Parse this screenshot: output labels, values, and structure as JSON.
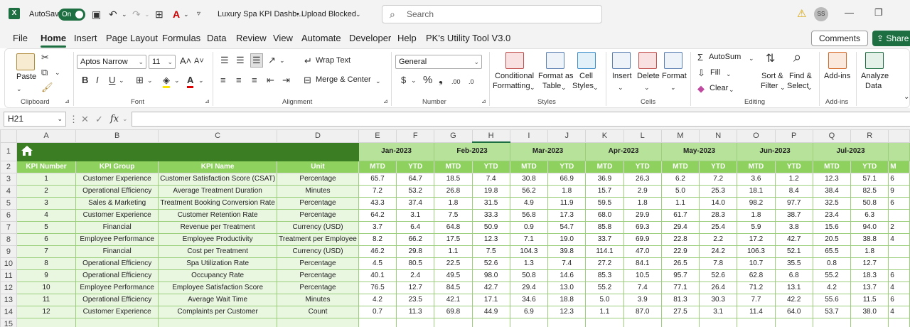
{
  "titlebar": {
    "autosave_label": "AutoSave",
    "autosave_state": "On",
    "file_title": "Luxury Spa KPI Dashb...",
    "status": "• Upload Blocked",
    "search_placeholder": "Search",
    "user_initials": "SS"
  },
  "menu": [
    "File",
    "Home",
    "Insert",
    "Page Layout",
    "Formulas",
    "Data",
    "Review",
    "View",
    "Automate",
    "Developer",
    "Help",
    "PK's Utility Tool V3.0"
  ],
  "menu_active": "Home",
  "buttons": {
    "comments": "Comments",
    "share": "Share"
  },
  "ribbon": {
    "clipboard": {
      "paste": "Paste",
      "label": "Clipboard"
    },
    "font": {
      "name": "Aptos Narrow",
      "size": "11",
      "label": "Font"
    },
    "alignment": {
      "wrap": "Wrap Text",
      "merge": "Merge & Center",
      "label": "Alignment"
    },
    "number": {
      "format": "General",
      "label": "Number"
    },
    "styles": {
      "cond_l1": "Conditional",
      "cond_l2": "Formatting",
      "fmt_l1": "Format as",
      "fmt_l2": "Table",
      "cell_l1": "Cell",
      "cell_l2": "Styles",
      "label": "Styles"
    },
    "cells": {
      "insert": "Insert",
      "delete": "Delete",
      "format": "Format",
      "label": "Cells"
    },
    "editing": {
      "autosum": "AutoSum",
      "fill": "Fill",
      "clear": "Clear",
      "sort_l1": "Sort &",
      "sort_l2": "Filter",
      "find_l1": "Find &",
      "find_l2": "Select",
      "label": "Editing"
    },
    "addins": {
      "btn": "Add-ins",
      "label": "Add-ins"
    },
    "analyze": {
      "l1": "Analyze",
      "l2": "Data"
    }
  },
  "formula_bar": {
    "name_box": "H21",
    "fx": "fx",
    "content": ""
  },
  "sheet": {
    "columns": [
      "A",
      "B",
      "C",
      "D",
      "E",
      "F",
      "G",
      "H",
      "I",
      "J",
      "K",
      "L",
      "M",
      "N",
      "O",
      "P",
      "Q",
      "R",
      ""
    ],
    "selected_column": "H",
    "row_numbers": [
      "1",
      "2",
      "3",
      "4",
      "5",
      "6",
      "7",
      "8",
      "9",
      "10",
      "11",
      "12",
      "13",
      "14",
      "15"
    ],
    "months": [
      "Jan-2023",
      "Feb-2023",
      "Mar-2023",
      "Apr-2023",
      "May-2023",
      "Jun-2023",
      "Jul-2023"
    ],
    "header": {
      "kpi_number": "KPI Number",
      "kpi_group": "KPI Group",
      "kpi_name": "KPI Name",
      "unit": "Unit",
      "mtd": "MTD",
      "ytd": "YTD",
      "partial": "M"
    },
    "rows": [
      {
        "n": "1",
        "group": "Customer Experience",
        "name": "Customer Satisfaction Score (CSAT)",
        "unit": "Percentage",
        "vals": [
          "65.7",
          "64.7",
          "18.5",
          "7.4",
          "30.8",
          "66.9",
          "36.9",
          "26.3",
          "6.2",
          "7.2",
          "3.6",
          "1.2",
          "12.3",
          "57.1"
        ],
        "edge": "6"
      },
      {
        "n": "2",
        "group": "Operational Efficiency",
        "name": "Average Treatment Duration",
        "unit": "Minutes",
        "vals": [
          "7.2",
          "53.2",
          "26.8",
          "19.8",
          "56.2",
          "1.8",
          "15.7",
          "2.9",
          "5.0",
          "25.3",
          "18.1",
          "8.4",
          "38.4",
          "82.5"
        ],
        "edge": "9"
      },
      {
        "n": "3",
        "group": "Sales & Marketing",
        "name": "Treatment Booking Conversion Rate",
        "unit": "Percentage",
        "vals": [
          "43.3",
          "37.4",
          "1.8",
          "31.5",
          "4.9",
          "11.9",
          "59.5",
          "1.8",
          "1.1",
          "14.0",
          "98.2",
          "97.7",
          "32.5",
          "50.8"
        ],
        "edge": "6"
      },
      {
        "n": "4",
        "group": "Customer Experience",
        "name": "Customer Retention Rate",
        "unit": "Percentage",
        "vals": [
          "64.2",
          "3.1",
          "7.5",
          "33.3",
          "56.8",
          "17.3",
          "68.0",
          "29.9",
          "61.7",
          "28.3",
          "1.8",
          "38.7",
          "23.4",
          "6.3"
        ],
        "edge": ""
      },
      {
        "n": "5",
        "group": "Financial",
        "name": "Revenue per Treatment",
        "unit": "Currency (USD)",
        "vals": [
          "3.7",
          "6.4",
          "64.8",
          "50.9",
          "0.9",
          "54.7",
          "85.8",
          "69.3",
          "29.4",
          "25.4",
          "5.9",
          "3.8",
          "15.6",
          "94.0"
        ],
        "edge": "2"
      },
      {
        "n": "6",
        "group": "Employee Performance",
        "name": "Employee Productivity",
        "unit": "Treatment per Employee",
        "vals": [
          "8.2",
          "66.2",
          "17.5",
          "12.3",
          "7.1",
          "19.0",
          "33.7",
          "69.9",
          "22.8",
          "2.2",
          "17.2",
          "42.7",
          "20.5",
          "38.8"
        ],
        "edge": "4"
      },
      {
        "n": "7",
        "group": "Financial",
        "name": "Cost per Treatment",
        "unit": "Currency (USD)",
        "vals": [
          "46.2",
          "29.8",
          "1.1",
          "7.5",
          "104.3",
          "39.8",
          "114.1",
          "47.0",
          "22.9",
          "24.2",
          "106.3",
          "52.1",
          "65.5",
          "1.8"
        ],
        "edge": ""
      },
      {
        "n": "8",
        "group": "Operational Efficiency",
        "name": "Spa Utilization Rate",
        "unit": "Percentage",
        "vals": [
          "4.5",
          "80.5",
          "22.5",
          "52.6",
          "1.3",
          "7.4",
          "27.2",
          "84.1",
          "26.5",
          "7.8",
          "10.7",
          "35.5",
          "0.8",
          "12.7"
        ],
        "edge": ""
      },
      {
        "n": "9",
        "group": "Operational Efficiency",
        "name": "Occupancy Rate",
        "unit": "Percentage",
        "vals": [
          "40.1",
          "2.4",
          "49.5",
          "98.0",
          "50.8",
          "14.6",
          "85.3",
          "10.5",
          "95.7",
          "52.6",
          "62.8",
          "6.8",
          "55.2",
          "18.3"
        ],
        "edge": "6"
      },
      {
        "n": "10",
        "group": "Employee Performance",
        "name": "Employee Satisfaction Score",
        "unit": "Percentage",
        "vals": [
          "76.5",
          "12.7",
          "84.5",
          "42.7",
          "29.4",
          "13.0",
          "55.2",
          "7.4",
          "77.1",
          "26.4",
          "71.2",
          "13.1",
          "4.2",
          "13.7"
        ],
        "edge": "4"
      },
      {
        "n": "11",
        "group": "Operational Efficiency",
        "name": "Average Wait Time",
        "unit": "Minutes",
        "vals": [
          "4.2",
          "23.5",
          "42.1",
          "17.1",
          "34.6",
          "18.8",
          "5.0",
          "3.9",
          "81.3",
          "30.3",
          "7.7",
          "42.2",
          "55.6",
          "11.5"
        ],
        "edge": "6"
      },
      {
        "n": "12",
        "group": "Customer Experience",
        "name": "Complaints per Customer",
        "unit": "Count",
        "vals": [
          "0.7",
          "11.3",
          "69.8",
          "44.9",
          "6.9",
          "12.3",
          "1.1",
          "87.0",
          "27.5",
          "3.1",
          "11.4",
          "64.0",
          "53.7",
          "38.0"
        ],
        "edge": "4"
      }
    ]
  },
  "colors": {
    "excel_green": "#1d6f42",
    "dark_green": "#3a7d22",
    "light_green": "#b6e29a",
    "mid_green": "#8ed15e",
    "row_tint": "#e9f6e0"
  },
  "icons": [
    "excel-logo-icon",
    "save-icon",
    "undo-icon",
    "redo-icon",
    "table-icon",
    "font-color-icon",
    "customize-icon",
    "search-icon",
    "warning-icon",
    "minimize-icon",
    "restore-icon",
    "home-icon"
  ]
}
